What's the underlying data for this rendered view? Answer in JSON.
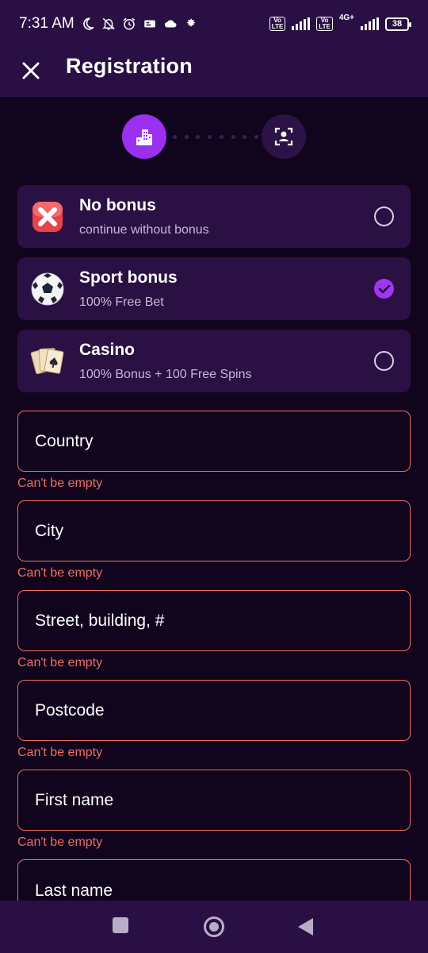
{
  "status_bar": {
    "time": "7:31 AM",
    "battery": "38",
    "network_1": "Vo LTE",
    "network_2": "Vo LTE",
    "network_3": "4G+"
  },
  "header": {
    "title": "Registration"
  },
  "bonuses": [
    {
      "title": "No bonus",
      "subtitle": "continue without bonus",
      "icon": "no-bonus-icon",
      "selected": false
    },
    {
      "title": "Sport bonus",
      "subtitle": "100% Free Bet",
      "icon": "soccer-ball-icon",
      "selected": true
    },
    {
      "title": "Casino",
      "subtitle": "100% Bonus + 100 Free Spins",
      "icon": "playing-cards-icon",
      "selected": false
    }
  ],
  "form": {
    "country": {
      "placeholder": "Country",
      "error": "Can't be empty"
    },
    "city": {
      "placeholder": "City",
      "error": "Can't be empty"
    },
    "street": {
      "placeholder": "Street, building, #",
      "error": "Can't be empty"
    },
    "postcode": {
      "placeholder": "Postcode",
      "error": "Can't be empty"
    },
    "first_name": {
      "placeholder": "First name",
      "error": "Can't be empty"
    },
    "last_name": {
      "placeholder": "Last name"
    }
  },
  "colors": {
    "accent": "#9b30f0",
    "error": "#ee6e63",
    "background": "#10051d",
    "card": "#2b1043"
  }
}
